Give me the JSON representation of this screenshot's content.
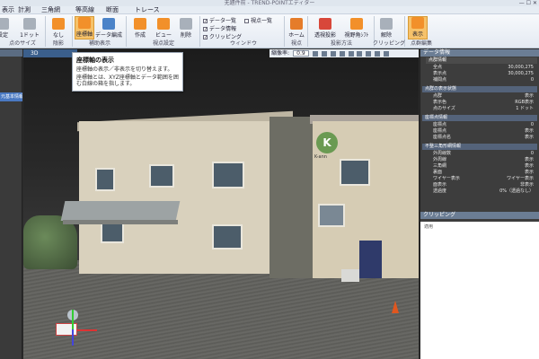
{
  "window": {
    "title": "无題件前 - TREND-POINTエディター",
    "controls": "— ☐ ✕"
  },
  "menu": [
    "表示",
    "計測",
    "三角網",
    "等高線",
    "断面",
    "トレース"
  ],
  "ribbon": {
    "buttons": [
      {
        "label": "設定"
      },
      {
        "label": "1ドット"
      },
      {
        "label": "なし"
      },
      {
        "label": "座標軸"
      },
      {
        "label": "データ編成"
      },
      {
        "label": "作成"
      },
      {
        "label": "ビュー"
      },
      {
        "label": "削除"
      },
      {
        "label": "ホーム"
      },
      {
        "label": "透視投影"
      },
      {
        "label": "視野角ｼﾌﾄ"
      },
      {
        "label": "解除"
      },
      {
        "label": "表示"
      }
    ],
    "checkboxes": [
      {
        "label": "データ一覧",
        "checked": true
      },
      {
        "label": "視点一覧",
        "checked": false
      },
      {
        "label": "データ情報",
        "checked": true
      },
      {
        "label": "クリッピング",
        "checked": true
      }
    ],
    "groups": [
      "点のサイズ",
      "陰影",
      "補助表示",
      "視点設定",
      "ウィンドウ",
      "視点",
      "投影方法",
      "クリッピング",
      "点群編集"
    ]
  },
  "viewport": {
    "tab": "3D",
    "zoom_label": "縮像率:",
    "zoom_value": "0.9",
    "logo_letter": "K",
    "logo_caption": "K-ann"
  },
  "tooltip": {
    "title": "座標軸の表示",
    "line1": "座標軸の表示／非表示を切り替えます。",
    "line2": "座標軸とは、XYZ座標軸とデータ範囲を囲む白線の箱を指します。"
  },
  "left_panel": {
    "tree_item": "元基本情報"
  },
  "right_panel": {
    "title": "データ情報",
    "sections": [
      {
        "name": "点群情報",
        "rows": [
          {
            "k": "全点",
            "v": "30,000,275"
          },
          {
            "k": "表示点",
            "v": "30,000,275"
          },
          {
            "k": "補間点",
            "v": "0"
          }
        ]
      },
      {
        "name": "点群の表示状態",
        "rows": [
          {
            "k": "点群",
            "v": "表示"
          },
          {
            "k": "表示色",
            "v": "RGB表示"
          },
          {
            "k": "点のサイズ",
            "v": "1 ドット"
          }
        ]
      },
      {
        "name": "座標点情報",
        "rows": [
          {
            "k": "座標点",
            "v": "0"
          },
          {
            "k": "座標点",
            "v": "表示"
          },
          {
            "k": "座標点名",
            "v": "表示"
          }
        ]
      },
      {
        "name": "不整三角形網情報",
        "rows": [
          {
            "k": "外周線数",
            "v": "0"
          },
          {
            "k": "外周線",
            "v": "表示"
          },
          {
            "k": "三角網",
            "v": "表示"
          },
          {
            "k": "裏面",
            "v": "表示"
          },
          {
            "k": "ワイヤー表示",
            "v": "ワイヤー表示"
          },
          {
            "k": "面表示",
            "v": "非表示"
          },
          {
            "k": "透過度",
            "v": "0%（透過なし）"
          }
        ]
      }
    ],
    "clipping_title": "クリッピング",
    "clipping_item": "適用"
  }
}
